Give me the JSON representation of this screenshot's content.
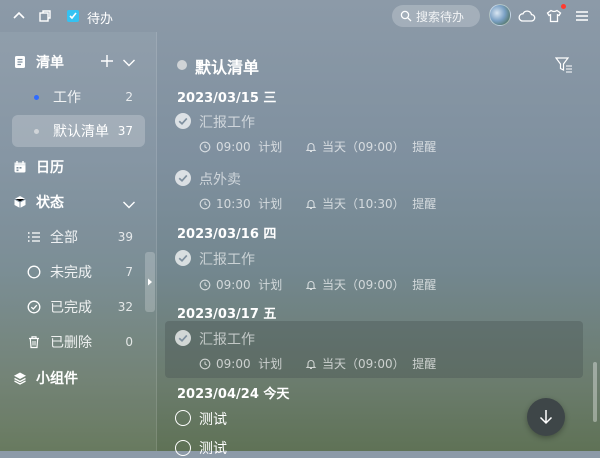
{
  "window": {
    "title": "待办",
    "search_placeholder": "搜索待办"
  },
  "sidebar": {
    "lists_header": "清单",
    "lists": [
      {
        "label": "工作",
        "count": "2",
        "dot_color": "#2f6bff"
      },
      {
        "label": "默认清单",
        "count": "37",
        "dot_color": "#d0d4d8"
      }
    ],
    "calendar_label": "日历",
    "status_header": "状态",
    "status_items": [
      {
        "label": "全部",
        "count": "39",
        "icon": "list-icon"
      },
      {
        "label": "未完成",
        "count": "7",
        "icon": "circle-icon"
      },
      {
        "label": "已完成",
        "count": "32",
        "icon": "check-circle-icon"
      },
      {
        "label": "已删除",
        "count": "0",
        "icon": "trash-icon"
      }
    ],
    "widgets_label": "小组件"
  },
  "main": {
    "list_title": "默认清单",
    "groups": [
      {
        "date": "2023/03/15  三",
        "tasks": [
          {
            "title": "汇报工作",
            "done": true,
            "time": "09:00",
            "time_label": "计划",
            "remind": "当天（09:00）",
            "remind_label": "提醒"
          },
          {
            "title": "点外卖",
            "done": true,
            "time": "10:30",
            "time_label": "计划",
            "remind": "当天（10:30）",
            "remind_label": "提醒"
          }
        ]
      },
      {
        "date": "2023/03/16  四",
        "tasks": [
          {
            "title": "汇报工作",
            "done": true,
            "time": "09:00",
            "time_label": "计划",
            "remind": "当天（09:00）",
            "remind_label": "提醒"
          }
        ]
      },
      {
        "date": "2023/03/17  五",
        "tasks": [
          {
            "title": "汇报工作",
            "done": true,
            "time": "09:00",
            "time_label": "计划",
            "remind": "当天（09:00）",
            "remind_label": "提醒"
          }
        ]
      },
      {
        "date": "2023/04/24  今天",
        "tasks": [
          {
            "title": "测试",
            "done": false
          },
          {
            "title": "测试",
            "done": false
          }
        ]
      }
    ]
  }
}
